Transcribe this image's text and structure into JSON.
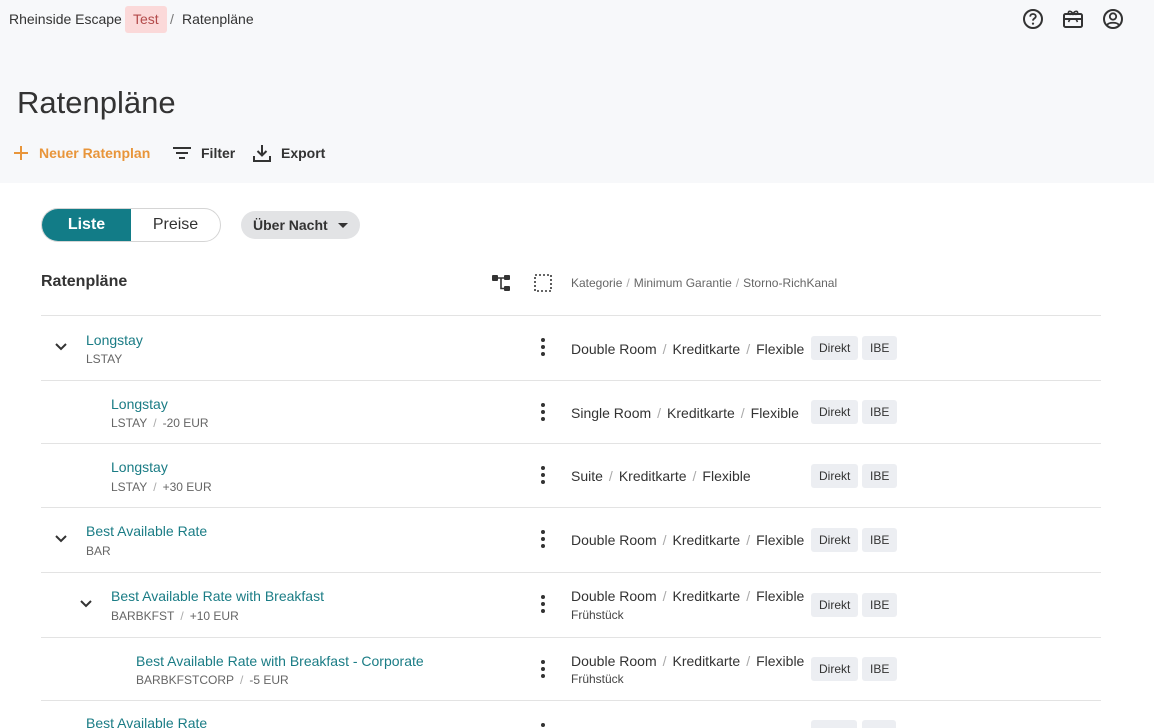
{
  "breadcrumb": {
    "app": "Rheinside Escape",
    "badge": "Test",
    "separator": "/",
    "page": "Ratenpläne"
  },
  "page_title": "Ratenpläne",
  "toolbar": {
    "new_label": "Neuer Ratenplan",
    "filter_label": "Filter",
    "export_label": "Export"
  },
  "view_toggle": {
    "list_label": "Liste",
    "prices_label": "Preise",
    "active": "Liste"
  },
  "period_select": {
    "label": "Über Nacht"
  },
  "table": {
    "title": "Ratenpläne",
    "col_header": {
      "c1": "Kategorie",
      "c2": "Minimum Garantie",
      "c3": "Storno-Rich",
      "c4": "Kanal"
    }
  },
  "rows": [
    {
      "name": "Longstay",
      "code": "LSTAY",
      "offset": "",
      "room": "Double Room",
      "payment": "Kreditkarte",
      "cancel": "Flexible",
      "extra": "",
      "channels": [
        "Direkt",
        "IBE"
      ]
    },
    {
      "name": "Longstay",
      "code": "LSTAY",
      "offset": "-20 EUR",
      "room": "Single Room",
      "payment": "Kreditkarte",
      "cancel": "Flexible",
      "extra": "",
      "channels": [
        "Direkt",
        "IBE"
      ]
    },
    {
      "name": "Longstay",
      "code": "LSTAY",
      "offset": "+30 EUR",
      "room": "Suite",
      "payment": "Kreditkarte",
      "cancel": "Flexible",
      "extra": "",
      "channels": [
        "Direkt",
        "IBE"
      ]
    },
    {
      "name": "Best Available Rate",
      "code": "BAR",
      "offset": "",
      "room": "Double Room",
      "payment": "Kreditkarte",
      "cancel": "Flexible",
      "extra": "",
      "channels": [
        "Direkt",
        "IBE"
      ]
    },
    {
      "name": "Best Available Rate with Breakfast",
      "code": "BARBKFST",
      "offset": "+10 EUR",
      "room": "Double Room",
      "payment": "Kreditkarte",
      "cancel": "Flexible",
      "extra": "Frühstück",
      "channels": [
        "Direkt",
        "IBE"
      ]
    },
    {
      "name": "Best Available Rate with Breakfast - Corporate",
      "code": "BARBKFSTCORP",
      "offset": "-5 EUR",
      "room": "Double Room",
      "payment": "Kreditkarte",
      "cancel": "Flexible",
      "extra": "Frühstück",
      "channels": [
        "Direkt",
        "IBE"
      ]
    },
    {
      "name": "Best Available Rate",
      "code": "",
      "offset": "",
      "room": "",
      "payment": "",
      "cancel": "",
      "extra": "",
      "channels": [
        "",
        ""
      ]
    }
  ]
}
